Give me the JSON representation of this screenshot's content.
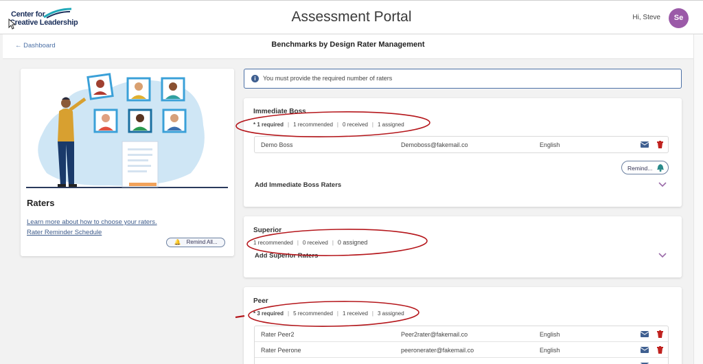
{
  "header": {
    "logo_line1": "Center for",
    "logo_line2": "Creative Leadership",
    "title": "Assessment Portal",
    "greeting": "Hi, Steve",
    "avatar_initials": "Se",
    "avatar_color": "#9b5aa8"
  },
  "subbar": {
    "back_label": "Dashboard",
    "title": "Benchmarks by Design Rater Management"
  },
  "left_panel": {
    "title": "Raters",
    "link1": "Learn more about how to choose your raters.",
    "link2": "Rater Reminder Schedule",
    "remind_all": "Remind All..."
  },
  "info": {
    "text": "You must provide the required number of raters"
  },
  "sections": [
    {
      "title": "Immediate Boss",
      "meta": [
        "* 1 required",
        "1 recommended",
        "0 received",
        "1 assigned"
      ],
      "raters": [
        {
          "name": "Demo Boss",
          "email": "Demoboss@fakemail.co",
          "language": "English"
        }
      ],
      "remind": "Remind...",
      "add_label": "Add Immediate Boss Raters"
    },
    {
      "title": "Superior",
      "meta": [
        "1 recommended",
        "0 received",
        "0 assigned"
      ],
      "add_label": "Add Superior Raters"
    },
    {
      "title": "Peer",
      "meta": [
        "* 3 required",
        "5 recommended",
        "1 received",
        "3 assigned"
      ],
      "raters": [
        {
          "name": "Rater Peer2",
          "email": "Peer2rater@fakemail.co",
          "language": "English"
        },
        {
          "name": "Rater Peerone",
          "email": "peeronerater@fakemail.co",
          "language": "English"
        }
      ]
    }
  ],
  "colors": {
    "accent": "#4a6fa5",
    "mail_icon": "#3f5f90",
    "trash_icon": "#c0221f",
    "annotation": "#b5161b"
  }
}
